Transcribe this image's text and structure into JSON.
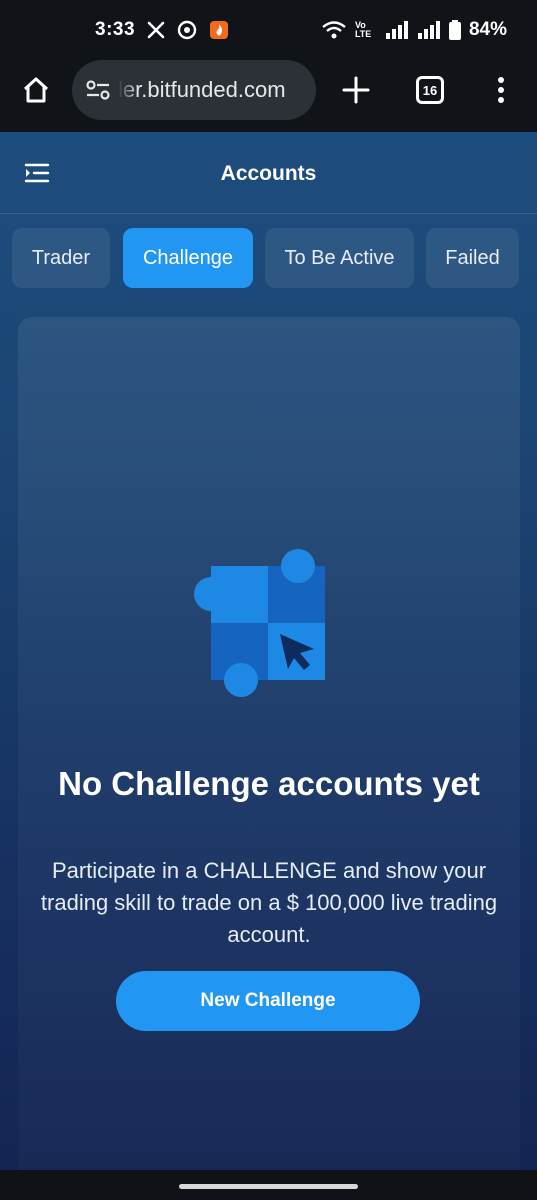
{
  "status_bar": {
    "time": "3:33",
    "network_label": "Vo LTE",
    "battery": "84%"
  },
  "browser": {
    "url": "ler.bitfunded.com",
    "tab_count": "16"
  },
  "app": {
    "title": "Accounts",
    "tabs": [
      {
        "label": "Trader",
        "active": false
      },
      {
        "label": "Challenge",
        "active": true
      },
      {
        "label": "To Be Active",
        "active": false
      },
      {
        "label": "Failed",
        "active": false
      }
    ],
    "empty_state": {
      "title": "No Challenge accounts yet",
      "description": "Participate in a CHALLENGE and show your trading skill to trade on a $ 100,000 live trading account.",
      "button_label": "New Challenge"
    }
  },
  "colors": {
    "accent": "#2196f3",
    "browser_bg": "#101418",
    "app_bg_top": "#1d4d7e",
    "app_bg_bottom": "#142452"
  }
}
